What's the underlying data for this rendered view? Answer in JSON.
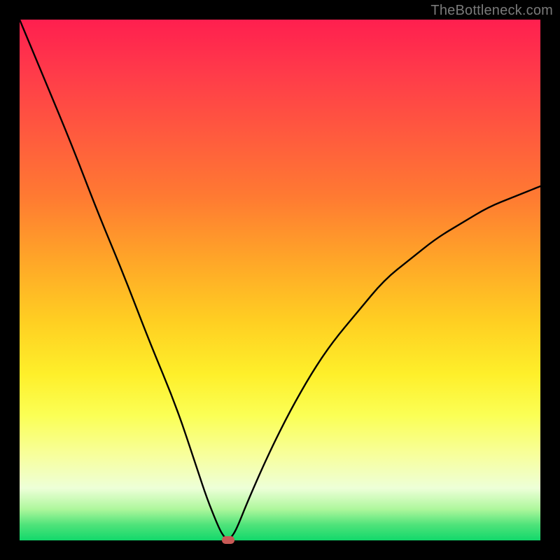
{
  "watermark": "TheBottleneck.com",
  "colors": {
    "frame": "#000000",
    "curve": "#000000",
    "marker": "#c85a56"
  },
  "chart_data": {
    "type": "line",
    "title": "",
    "xlabel": "",
    "ylabel": "",
    "xlim": [
      0,
      100
    ],
    "ylim": [
      0,
      100
    ],
    "grid": false,
    "legend": false,
    "note": "Axes are normalized 0–100 (no tick labels visible in source).",
    "background_gradient": {
      "orientation": "vertical",
      "stops": [
        {
          "pos": 0,
          "color": "#ff1f4f"
        },
        {
          "pos": 50,
          "color": "#ffb724"
        },
        {
          "pos": 75,
          "color": "#fbff55"
        },
        {
          "pos": 100,
          "color": "#12d86b"
        }
      ]
    },
    "series": [
      {
        "name": "bottleneck-curve",
        "x": [
          0,
          5,
          10,
          15,
          20,
          25,
          30,
          34,
          36,
          38,
          39,
          40,
          41,
          42,
          44,
          48,
          52,
          56,
          60,
          65,
          70,
          75,
          80,
          85,
          90,
          95,
          100
        ],
        "y": [
          100,
          88,
          76,
          63,
          51,
          38,
          26,
          14,
          8,
          3,
          1,
          0,
          1,
          3,
          8,
          17,
          25,
          32,
          38,
          44,
          50,
          54,
          58,
          61,
          64,
          66,
          68
        ]
      }
    ],
    "marker": {
      "x": 40,
      "y": 0
    }
  }
}
